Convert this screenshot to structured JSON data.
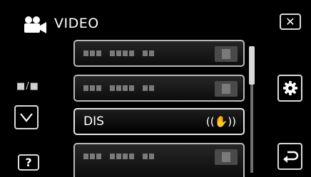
{
  "header": {
    "mode_icon": "video-camera-icon",
    "title": "VIDEO"
  },
  "close_button": {
    "icon": "close-x-icon",
    "glyph": "✕"
  },
  "page_indicator": "■/■",
  "down_button": {
    "icon": "chevron-down-icon"
  },
  "help_button": {
    "label": "?"
  },
  "settings_button": {
    "icon": "gear-icon"
  },
  "back_button": {
    "icon": "return-arrow-icon"
  },
  "menu": {
    "items": [
      {
        "label": "",
        "value": "",
        "placeholder": true
      },
      {
        "label": "",
        "value": "",
        "placeholder": true
      },
      {
        "label": "DIS",
        "value": "((✋))",
        "selected": true
      },
      {
        "label": "",
        "value": "",
        "placeholder": true
      }
    ]
  },
  "scroll": {
    "position": 0,
    "visible_fraction": 0.3
  }
}
